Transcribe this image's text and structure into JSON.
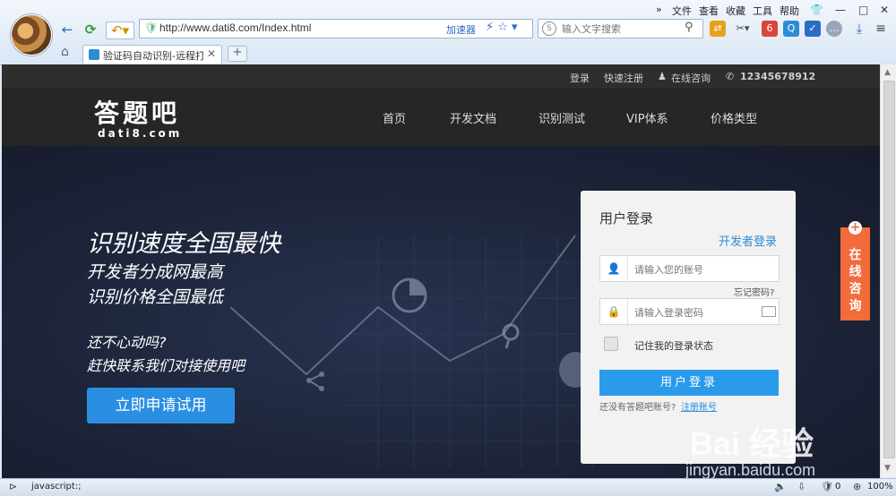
{
  "browser": {
    "menu": [
      "文件",
      "查看",
      "收藏",
      "工具",
      "帮助"
    ],
    "url": "http://www.dati8.com/Index.html",
    "accelerator_label": "加速器",
    "search_placeholder": "输入文字搜索",
    "tab_title": "验证码自动识别-远程打码",
    "status_text": "javascript:;",
    "status_count": "0",
    "zoom": "100%"
  },
  "site": {
    "topbar": {
      "login": "登录",
      "register": "快速注册",
      "online": "在线咨询",
      "phone": "12345678912"
    },
    "logo": {
      "main": "答题吧",
      "sub": "dati8.com"
    },
    "nav": [
      "首页",
      "开发文档",
      "识别测试",
      "VIP体系",
      "价格类型"
    ],
    "hero": {
      "headline": "识别速度全国最快",
      "line2": "开发者分成网最高",
      "line3": "识别价格全国最低",
      "line4": "还不心动吗?",
      "line5": "赶快联系我们对接使用吧",
      "cta": "立即申请试用"
    },
    "login": {
      "title": "用户登录",
      "dev_login": "开发者登录",
      "account_placeholder": "请输入您的账号",
      "forgot": "忘记密码?",
      "password_placeholder": "请输入登录密码",
      "remember": "记住我的登录状态",
      "submit": "用户登录",
      "no_account": "还没有答题吧账号?",
      "register": "注册账号"
    },
    "consult": "在线咨询"
  },
  "watermark": {
    "text": "Bai  经验",
    "sub": "jingyan.baidu.com"
  }
}
